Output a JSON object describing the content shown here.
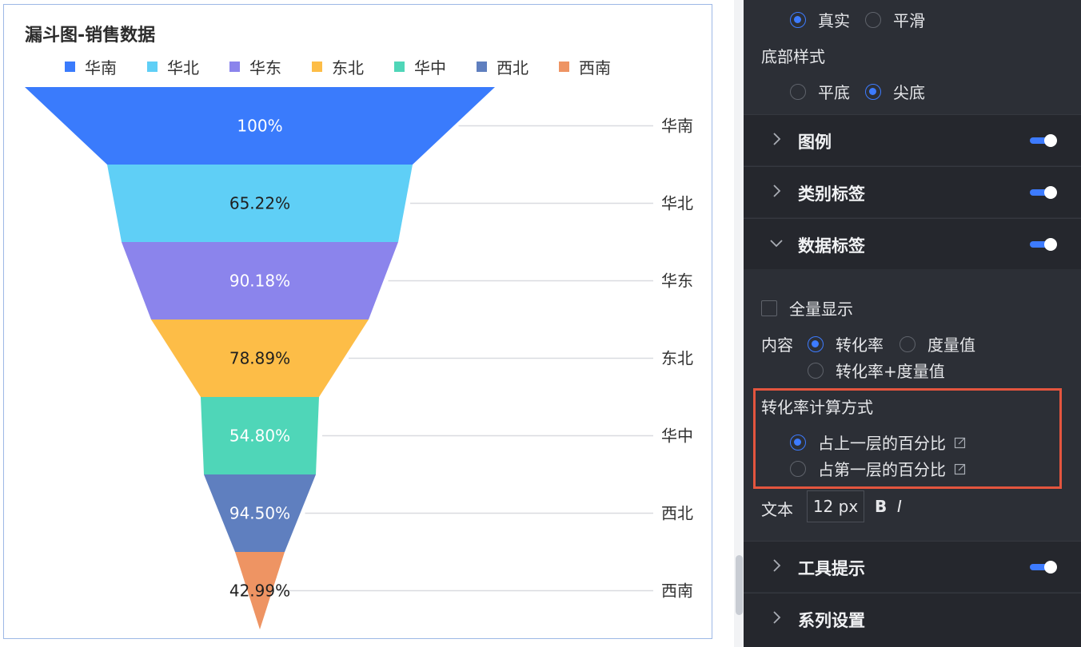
{
  "chart_card": {
    "title": "漏斗图-销售数据",
    "legend": [
      {
        "label": "华南",
        "color": "#3a7bfc"
      },
      {
        "label": "华北",
        "color": "#5fcff6"
      },
      {
        "label": "华东",
        "color": "#8b84ec"
      },
      {
        "label": "东北",
        "color": "#fdbd47"
      },
      {
        "label": "华中",
        "color": "#4fd6b8"
      },
      {
        "label": "西北",
        "color": "#5f7fbf"
      },
      {
        "label": "西南",
        "color": "#ee9463"
      }
    ]
  },
  "chart_data": {
    "type": "funnel",
    "categories": [
      "华南",
      "华北",
      "华东",
      "东北",
      "华中",
      "西北",
      "西南"
    ],
    "values_percent_label": [
      "100%",
      "65.22%",
      "90.18%",
      "78.89%",
      "54.80%",
      "94.50%",
      "42.99%"
    ],
    "conversion_rate": [
      100,
      65.22,
      90.18,
      78.89,
      54.8,
      94.5,
      42.99
    ],
    "colors": [
      "#3a7bfc",
      "#5fcff6",
      "#8b84ec",
      "#fdbd47",
      "#4fd6b8",
      "#5f7fbf",
      "#ee9463"
    ],
    "label_text_colors": [
      "#ffffff",
      "#1f1f1f",
      "#ffffff",
      "#1f1f1f",
      "#ffffff",
      "#ffffff",
      "#1f1f1f"
    ],
    "bottom_style": "尖底"
  },
  "panel": {
    "shape_options": [
      {
        "label": "真实",
        "selected": true
      },
      {
        "label": "平滑",
        "selected": false
      }
    ],
    "bottom_style_label": "底部样式",
    "bottom_options": [
      {
        "label": "平底",
        "selected": false
      },
      {
        "label": "尖底",
        "selected": true
      }
    ],
    "sections": {
      "legend": "图例",
      "category_labels": "类别标签",
      "data_labels": "数据标签",
      "tooltip": "工具提示",
      "series_settings": "系列设置"
    },
    "show_all_label": "全量显示",
    "content_label": "内容",
    "content_options": [
      {
        "label": "转化率",
        "selected": true
      },
      {
        "label": "度量值",
        "selected": false
      },
      {
        "label": "转化率+度量值",
        "selected": false
      }
    ],
    "calc_method_title": "转化率计算方式",
    "calc_options": [
      {
        "label": "占上一层的百分比",
        "selected": true
      },
      {
        "label": "占第一层的百分比",
        "selected": false
      }
    ],
    "text_label": "文本",
    "font_size": "12 px",
    "bold_label": "B",
    "italic_label": "I"
  }
}
